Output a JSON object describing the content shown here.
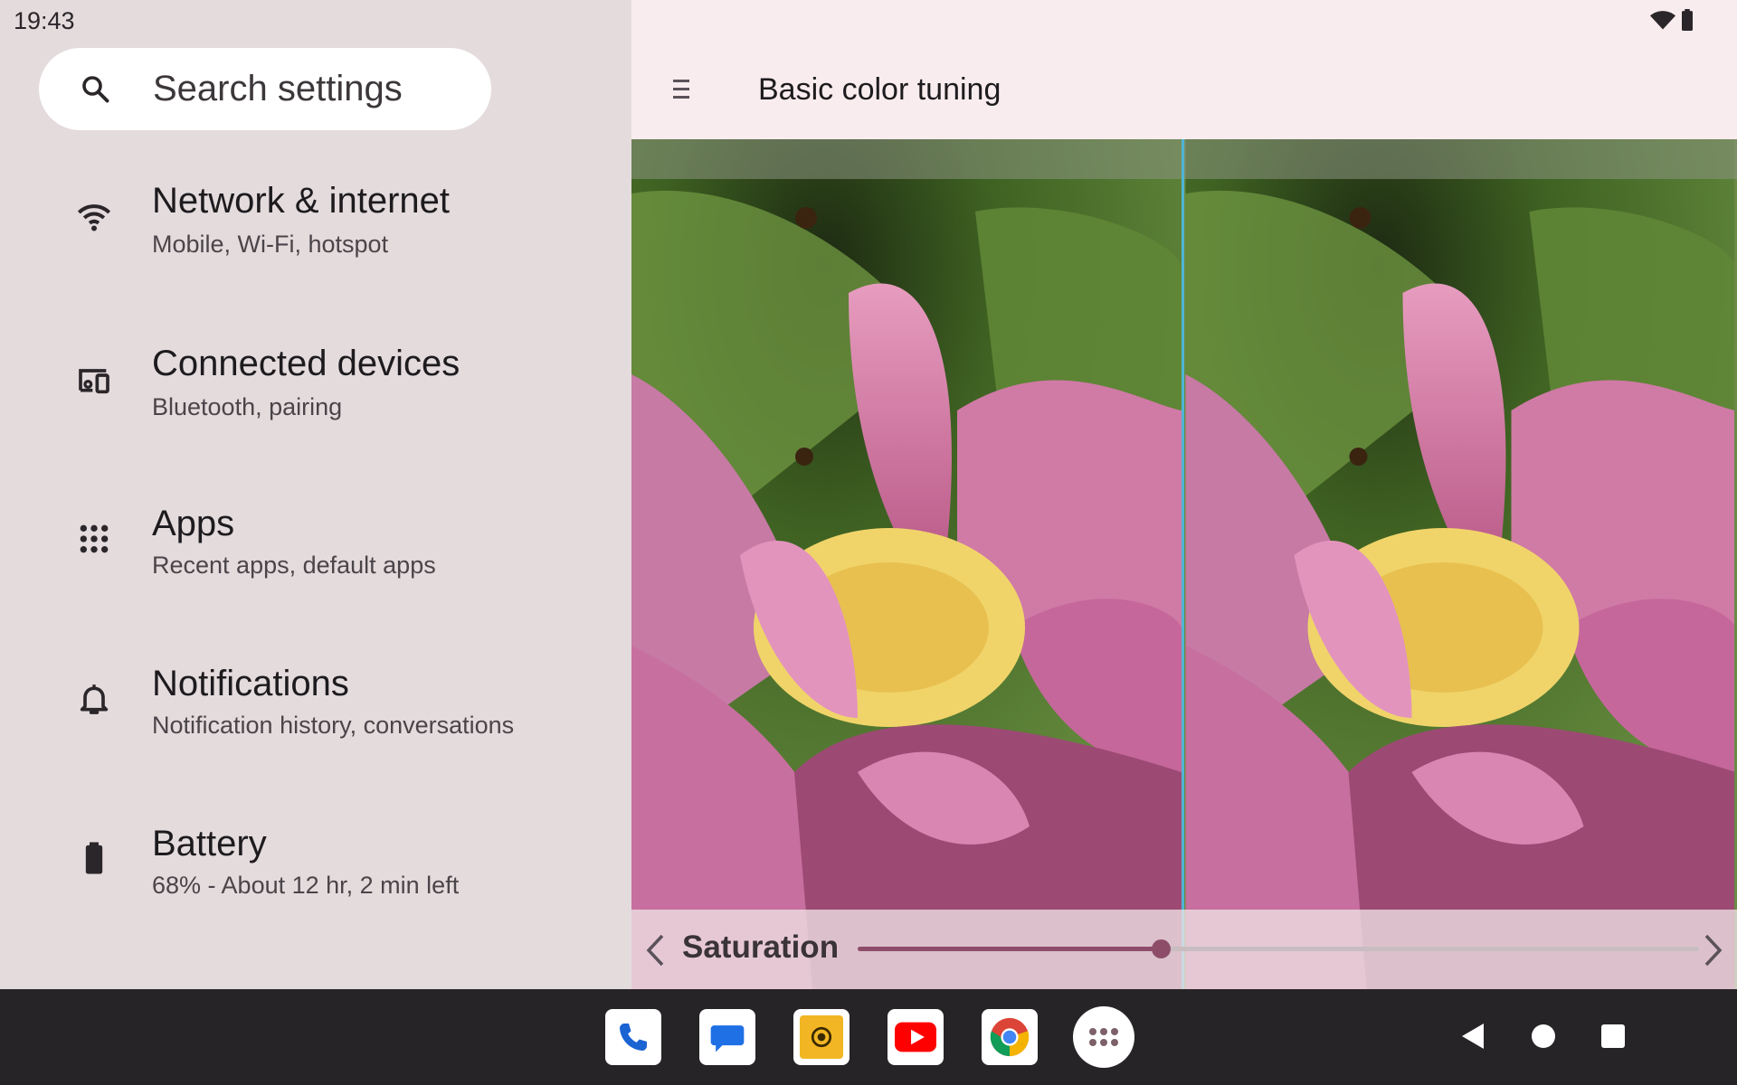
{
  "status_bar": {
    "time": "19:43",
    "icons": [
      "wifi-icon",
      "battery-icon"
    ]
  },
  "search": {
    "placeholder": "Search settings",
    "icon": "search-icon"
  },
  "settings_items": [
    {
      "icon": "wifi-icon",
      "title": "Network & internet",
      "subtitle": "Mobile, Wi-Fi, hotspot"
    },
    {
      "icon": "devices-icon",
      "title": "Connected devices",
      "subtitle": "Bluetooth, pairing"
    },
    {
      "icon": "apps-grid-icon",
      "title": "Apps",
      "subtitle": "Recent apps, default apps"
    },
    {
      "icon": "bell-icon",
      "title": "Notifications",
      "subtitle": "Notification history, conversations"
    },
    {
      "icon": "battery-icon",
      "title": "Battery",
      "subtitle": "68% - About 12 hr, 2 min left"
    }
  ],
  "detail": {
    "menu_icon": "menu-icon",
    "title": "Basic color tuning",
    "adjustment": {
      "label": "Saturation",
      "value_fraction": 0.36
    }
  },
  "colors": {
    "accent": "#8d4d69",
    "divider": "#4fb5d6",
    "left_bg": "#e4dbdd",
    "right_bg": "#f9ecee",
    "taskbar_bg": "#272427"
  },
  "taskbar": {
    "apps": [
      "phone-icon",
      "messages-icon",
      "camera-icon",
      "youtube-icon",
      "chrome-icon",
      "app-drawer-icon"
    ],
    "nav": [
      "back-icon",
      "home-icon",
      "recents-icon"
    ]
  }
}
